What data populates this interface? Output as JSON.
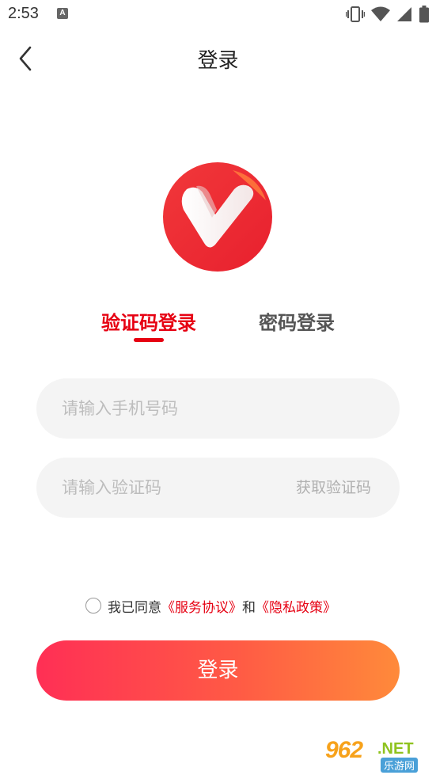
{
  "status_bar": {
    "time": "2:53",
    "notification_icon": "A"
  },
  "header": {
    "title": "登录"
  },
  "tabs": {
    "sms_label": "验证码登录",
    "password_label": "密码登录",
    "active": "sms"
  },
  "form": {
    "phone_placeholder": "请输入手机号码",
    "code_placeholder": "请输入验证码",
    "get_code_label": "获取验证码"
  },
  "agreement": {
    "prefix": "我已同意",
    "service_link": "《服务协议》",
    "and": "和",
    "privacy_link": "《隐私政策》"
  },
  "login_button": {
    "label": "登录"
  },
  "watermark": {
    "number": "962",
    "suffix": ".NET",
    "cn": "乐游网"
  },
  "colors": {
    "accent": "#e60012",
    "button_gradient_start": "#ff2f55",
    "button_gradient_end": "#ff8a3a",
    "input_bg": "#f4f4f4"
  },
  "icons": {
    "back": "chevron-left-icon",
    "logo": "heart-v-logo",
    "vibrate": "vibrate-icon",
    "wifi": "wifi-icon",
    "signal": "signal-icon",
    "battery": "battery-icon"
  }
}
